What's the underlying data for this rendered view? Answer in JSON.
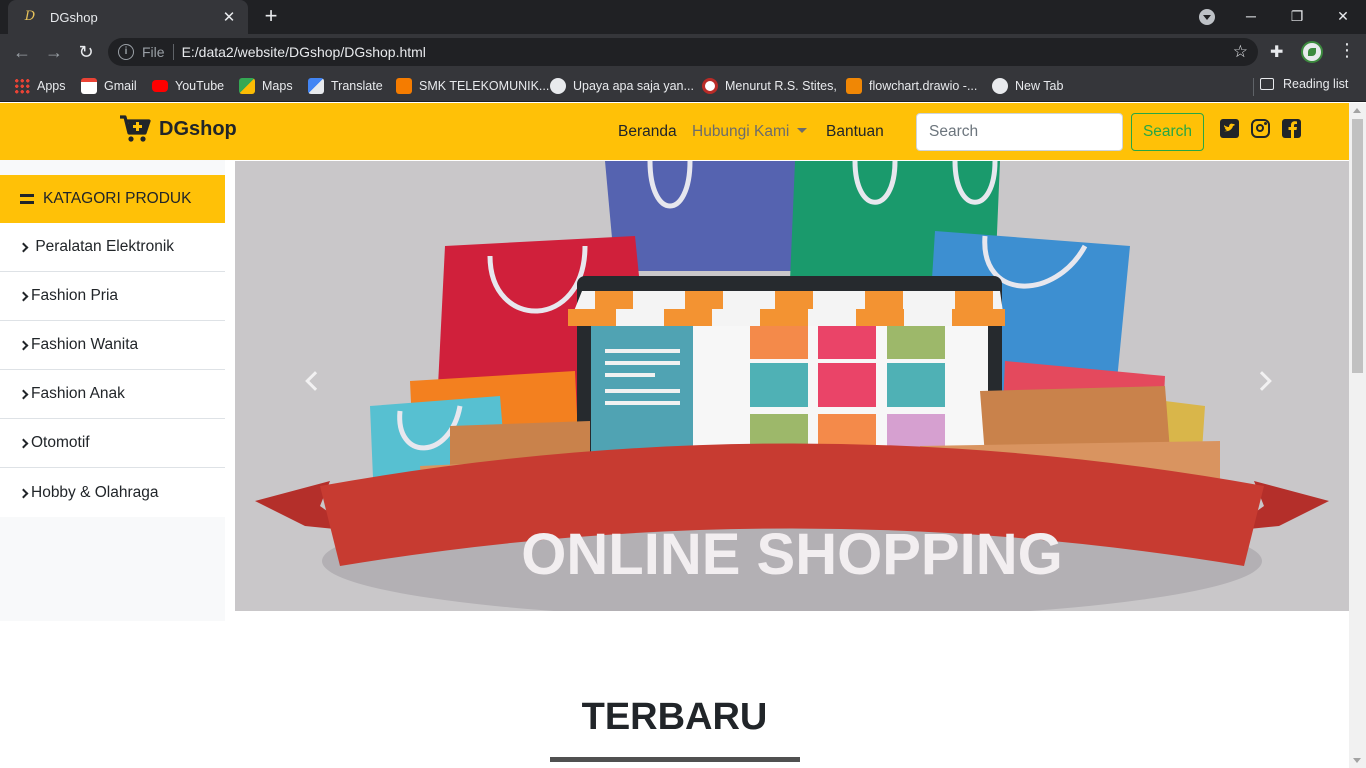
{
  "browser": {
    "tab_title": "DGshop",
    "tab_favicon": "D",
    "scheme": "File",
    "url": "E:/data2/website/DGshop/DGshop.html",
    "icons": [
      "back-icon",
      "forward-icon",
      "reload-icon",
      "info-icon",
      "star-icon",
      "extensions-icon",
      "menu-icon"
    ]
  },
  "bookmarks": [
    {
      "label": "Apps",
      "color": "#4285f4"
    },
    {
      "label": "Gmail",
      "color": "#ea4335"
    },
    {
      "label": "YouTube",
      "color": "#ff0000"
    },
    {
      "label": "Maps",
      "color": "#34a853"
    },
    {
      "label": "Translate",
      "color": "#4285f4"
    },
    {
      "label": "SMK TELEKOMUNIK...",
      "color": "#f57c00"
    },
    {
      "label": "Upaya apa saja yan...",
      "color": "#e8eaed"
    },
    {
      "label": "Menurut R.S. Stites,",
      "color": "#b92b27"
    },
    {
      "label": "flowchart.drawio -...",
      "color": "#f08705"
    },
    {
      "label": "New Tab",
      "color": "#e8eaed"
    }
  ],
  "reading_list": "Reading list",
  "navbar": {
    "brand": "DGshop",
    "links": [
      "Beranda",
      "Hubungi Kami",
      "Bantuan"
    ],
    "search_placeholder": "Search",
    "search_button": "Search",
    "social_icons": [
      "twitter-icon",
      "instagram-icon",
      "facebook-icon"
    ],
    "color": "#ffc107"
  },
  "sidebar": {
    "heading": "KATAGORI PRODUK",
    "items": [
      {
        "label": "Peralatan Elektronik"
      },
      {
        "label": "Fashion Pria"
      },
      {
        "label": "Fashion Wanita"
      },
      {
        "label": "Fashion Anak"
      },
      {
        "label": "Otomotif"
      },
      {
        "label": "Hobby & Olahraga"
      }
    ]
  },
  "banner": {
    "text": "ONLINE SHOPPING"
  },
  "section": {
    "title": "TERBARU"
  }
}
